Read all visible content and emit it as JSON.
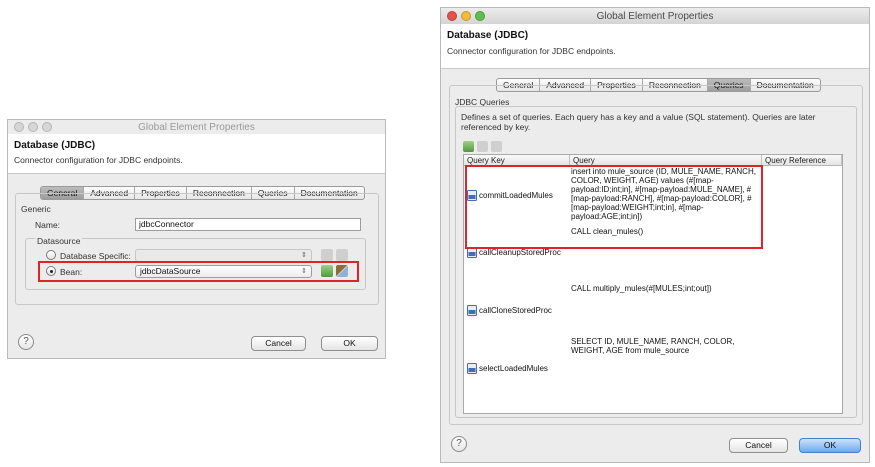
{
  "left": {
    "title": "Global Element Properties",
    "heading": "Database (JDBC)",
    "subtitle": "Connector configuration for JDBC endpoints.",
    "tabs": [
      "General",
      "Advanced",
      "Properties",
      "Reconnection",
      "Queries",
      "Documentation"
    ],
    "active_tab": "General",
    "group_generic": "Generic",
    "name_label": "Name:",
    "name_value": "jdbcConnector",
    "group_datasource": "Datasource",
    "radio_database_specific": "Database Specific:",
    "radio_bean": "Bean:",
    "bean_value": "jdbcDataSource",
    "help": "?",
    "cancel": "Cancel",
    "ok": "OK"
  },
  "right": {
    "title": "Global Element Properties",
    "heading": "Database (JDBC)",
    "subtitle": "Connector configuration for JDBC endpoints.",
    "tabs": [
      "General",
      "Advanced",
      "Properties",
      "Reconnection",
      "Queries",
      "Documentation"
    ],
    "active_tab": "Queries",
    "group_title": "JDBC Queries",
    "description": "Defines a set of queries. Each query has a key and a value (SQL statement). Queries are later referenced by key.",
    "columns": [
      "Query Key",
      "Query",
      "Query Reference"
    ],
    "rows": [
      {
        "key": "commitLoadedMules",
        "query": "insert into mule_source (ID, MULE_NAME, RANCH, COLOR, WEIGHT, AGE) values (#[map-payload:ID;int;in], #[map-payload:MULE_NAME], #[map-payload:RANCH], #[map-payload:COLOR], #[map-payload:WEIGHT;int;in], #[map-payload:AGE;int;in])"
      },
      {
        "key": "callCleanupStoredProc",
        "query": "CALL clean_mules()"
      },
      {
        "key": "callCloneStoredProc",
        "query": "CALL multiply_mules(#[MULES;int;out])"
      },
      {
        "key": "selectLoadedMules",
        "query": "SELECT ID, MULE_NAME, RANCH, COLOR, WEIGHT, AGE from mule_source"
      }
    ],
    "help": "?",
    "cancel": "Cancel",
    "ok": "OK"
  },
  "colors": {
    "highlight_red": "#e0232a",
    "close_light": "#e5524a",
    "minimize_light": "#f2bb3b",
    "zoom_light": "#5fbf4d",
    "ok_blue": "#6fa9ee"
  },
  "icons": {
    "add": "add-icon",
    "edit": "edit-icon",
    "delete": "delete-icon",
    "sql": "sql-query-icon"
  }
}
